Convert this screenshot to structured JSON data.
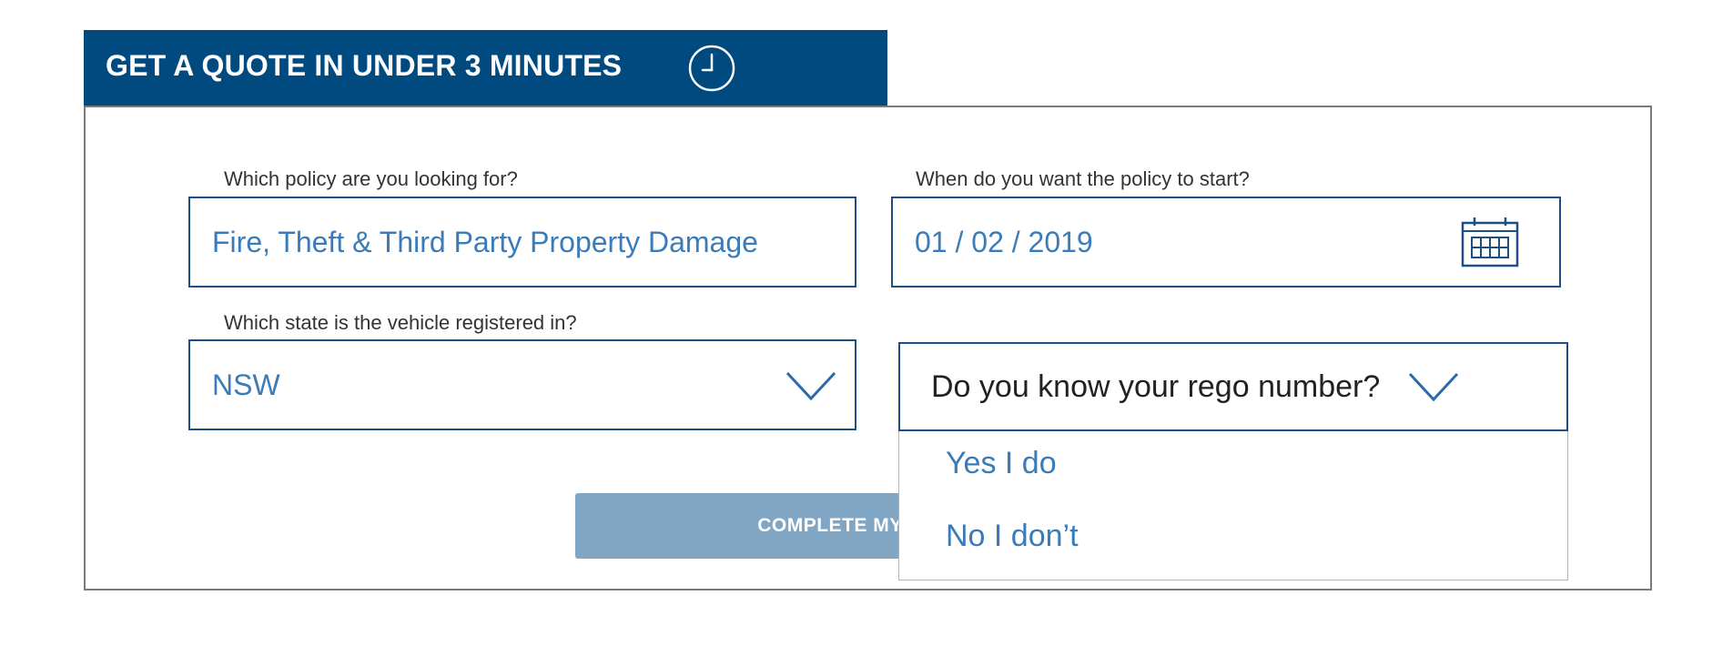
{
  "header": {
    "title": "GET A QUOTE IN UNDER 3 MINUTES",
    "icon": "clock-icon"
  },
  "form": {
    "policy": {
      "label": "Which policy are you looking for?",
      "value": "Fire, Theft & Third Party Property Damage"
    },
    "start_date": {
      "label": "When do you want the policy to start?",
      "value": "01 / 02 / 2019",
      "icon": "calendar-icon"
    },
    "state": {
      "label": "Which state is the vehicle registered in?",
      "value": "NSW",
      "icon": "chevron-down-icon"
    },
    "rego": {
      "prompt": "Do you know your rego number?",
      "icon": "chevron-down-icon",
      "options": [
        "Yes I do",
        "No I don’t"
      ]
    },
    "submit": {
      "visible_label": "COMPLETE MY"
    }
  },
  "colors": {
    "brand_navy": "#004a80",
    "field_border": "#1d4f86",
    "value_blue": "#3a7bb8",
    "button_disabled": "#81a6c4"
  }
}
